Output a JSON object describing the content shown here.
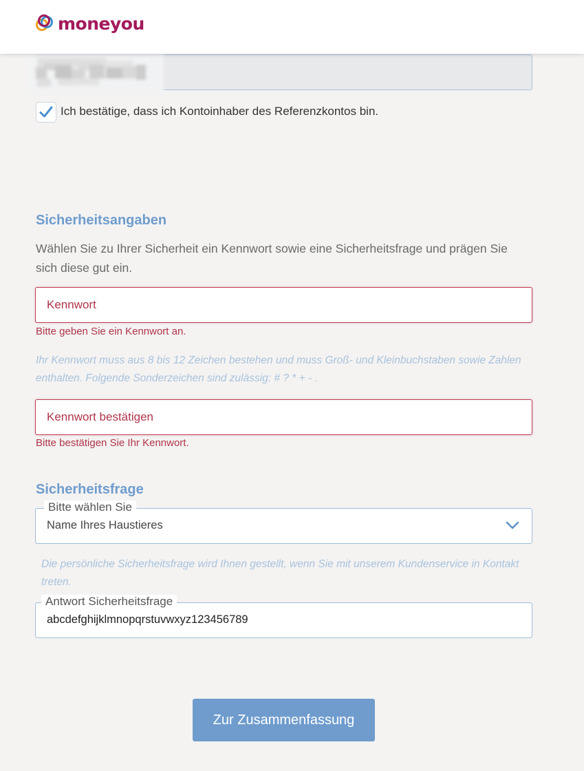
{
  "brand": {
    "name": "moneyou",
    "color": "#a3195b"
  },
  "confirm_owner": {
    "checked": true,
    "label": "Ich bestätige, dass ich Kontoinhaber des Referenzkontos bin."
  },
  "security": {
    "title": "Sicherheitsangaben",
    "intro": "Wählen Sie zu Ihrer Sicherheit ein Kennwort sowie eine Sicherheitsfrage und prägen Sie sich diese gut ein.",
    "password": {
      "placeholder": "Kennwort",
      "error": "Bitte geben Sie ein Kennwort an."
    },
    "password_hint": "Ihr Kennwort muss aus 8 bis 12 Zeichen bestehen und muss Groß- und Kleinbuchstaben sowie Zahlen enthalten. Folgende Sonderzeichen sind zulässig: # ? * + - .",
    "password_confirm": {
      "placeholder": "Kennwort bestätigen",
      "error": "Bitte bestätigen Sie Ihr Kennwort."
    }
  },
  "security_question": {
    "title": "Sicherheitsfrage",
    "select_label": "Bitte wählen Sie",
    "selected_value": "Name Ihres Haustieres",
    "hint": "Die persönliche Sicherheitsfrage wird Ihnen gestellt, wenn Sie mit unserem Kundenservice in Kontakt treten.",
    "answer_label": "Antwort Sicherheitsfrage",
    "answer_value": "abcdefghijklmnopqrstuvwxyz123456789"
  },
  "submit_label": "Zur Zusammenfassung",
  "colors": {
    "accent": "#6f9ccd",
    "error": "#b03449",
    "hint": "#a9c2dd",
    "background": "#f4f3f2"
  },
  "icons": [
    "moneyou-logo-icon",
    "checkmark-icon",
    "chevron-down-icon"
  ]
}
